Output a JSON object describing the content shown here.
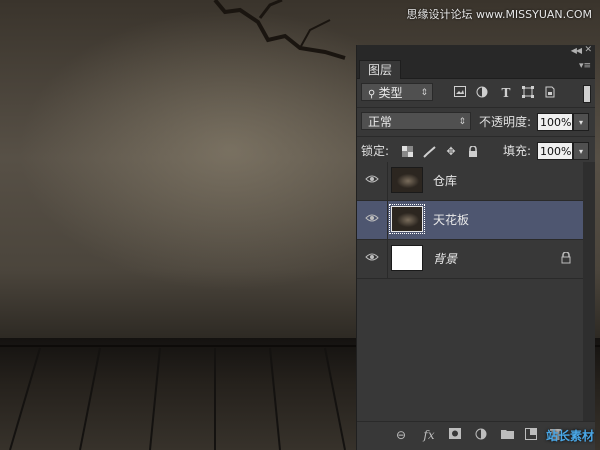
{
  "watermark_top": "思缘设计论坛 www.MISSYUAN.COM",
  "watermark_bottom": "站长素材",
  "panel": {
    "tab_label": "图层",
    "filter": {
      "kind_label": "类型"
    },
    "blend_mode": "正常",
    "opacity_label": "不透明度:",
    "opacity_value": "100%",
    "lock_label": "锁定:",
    "fill_label": "填充:",
    "fill_value": "100%",
    "layers": [
      {
        "name": "仓库",
        "thumb": "dark",
        "selected": false,
        "locked": false,
        "visible": true
      },
      {
        "name": "天花板",
        "thumb": "dark",
        "selected": true,
        "locked": false,
        "visible": true
      },
      {
        "name": "背景",
        "thumb": "white",
        "selected": false,
        "locked": true,
        "visible": true
      }
    ],
    "footer_icons": [
      "link-icon",
      "fx-icon",
      "mask-icon",
      "adjustment-icon",
      "group-folder-icon",
      "new-layer-icon",
      "trash-icon"
    ],
    "footer_fx": "fx"
  },
  "colors": {
    "panel_bg": "#383838",
    "selected_layer": "#4e5670"
  }
}
